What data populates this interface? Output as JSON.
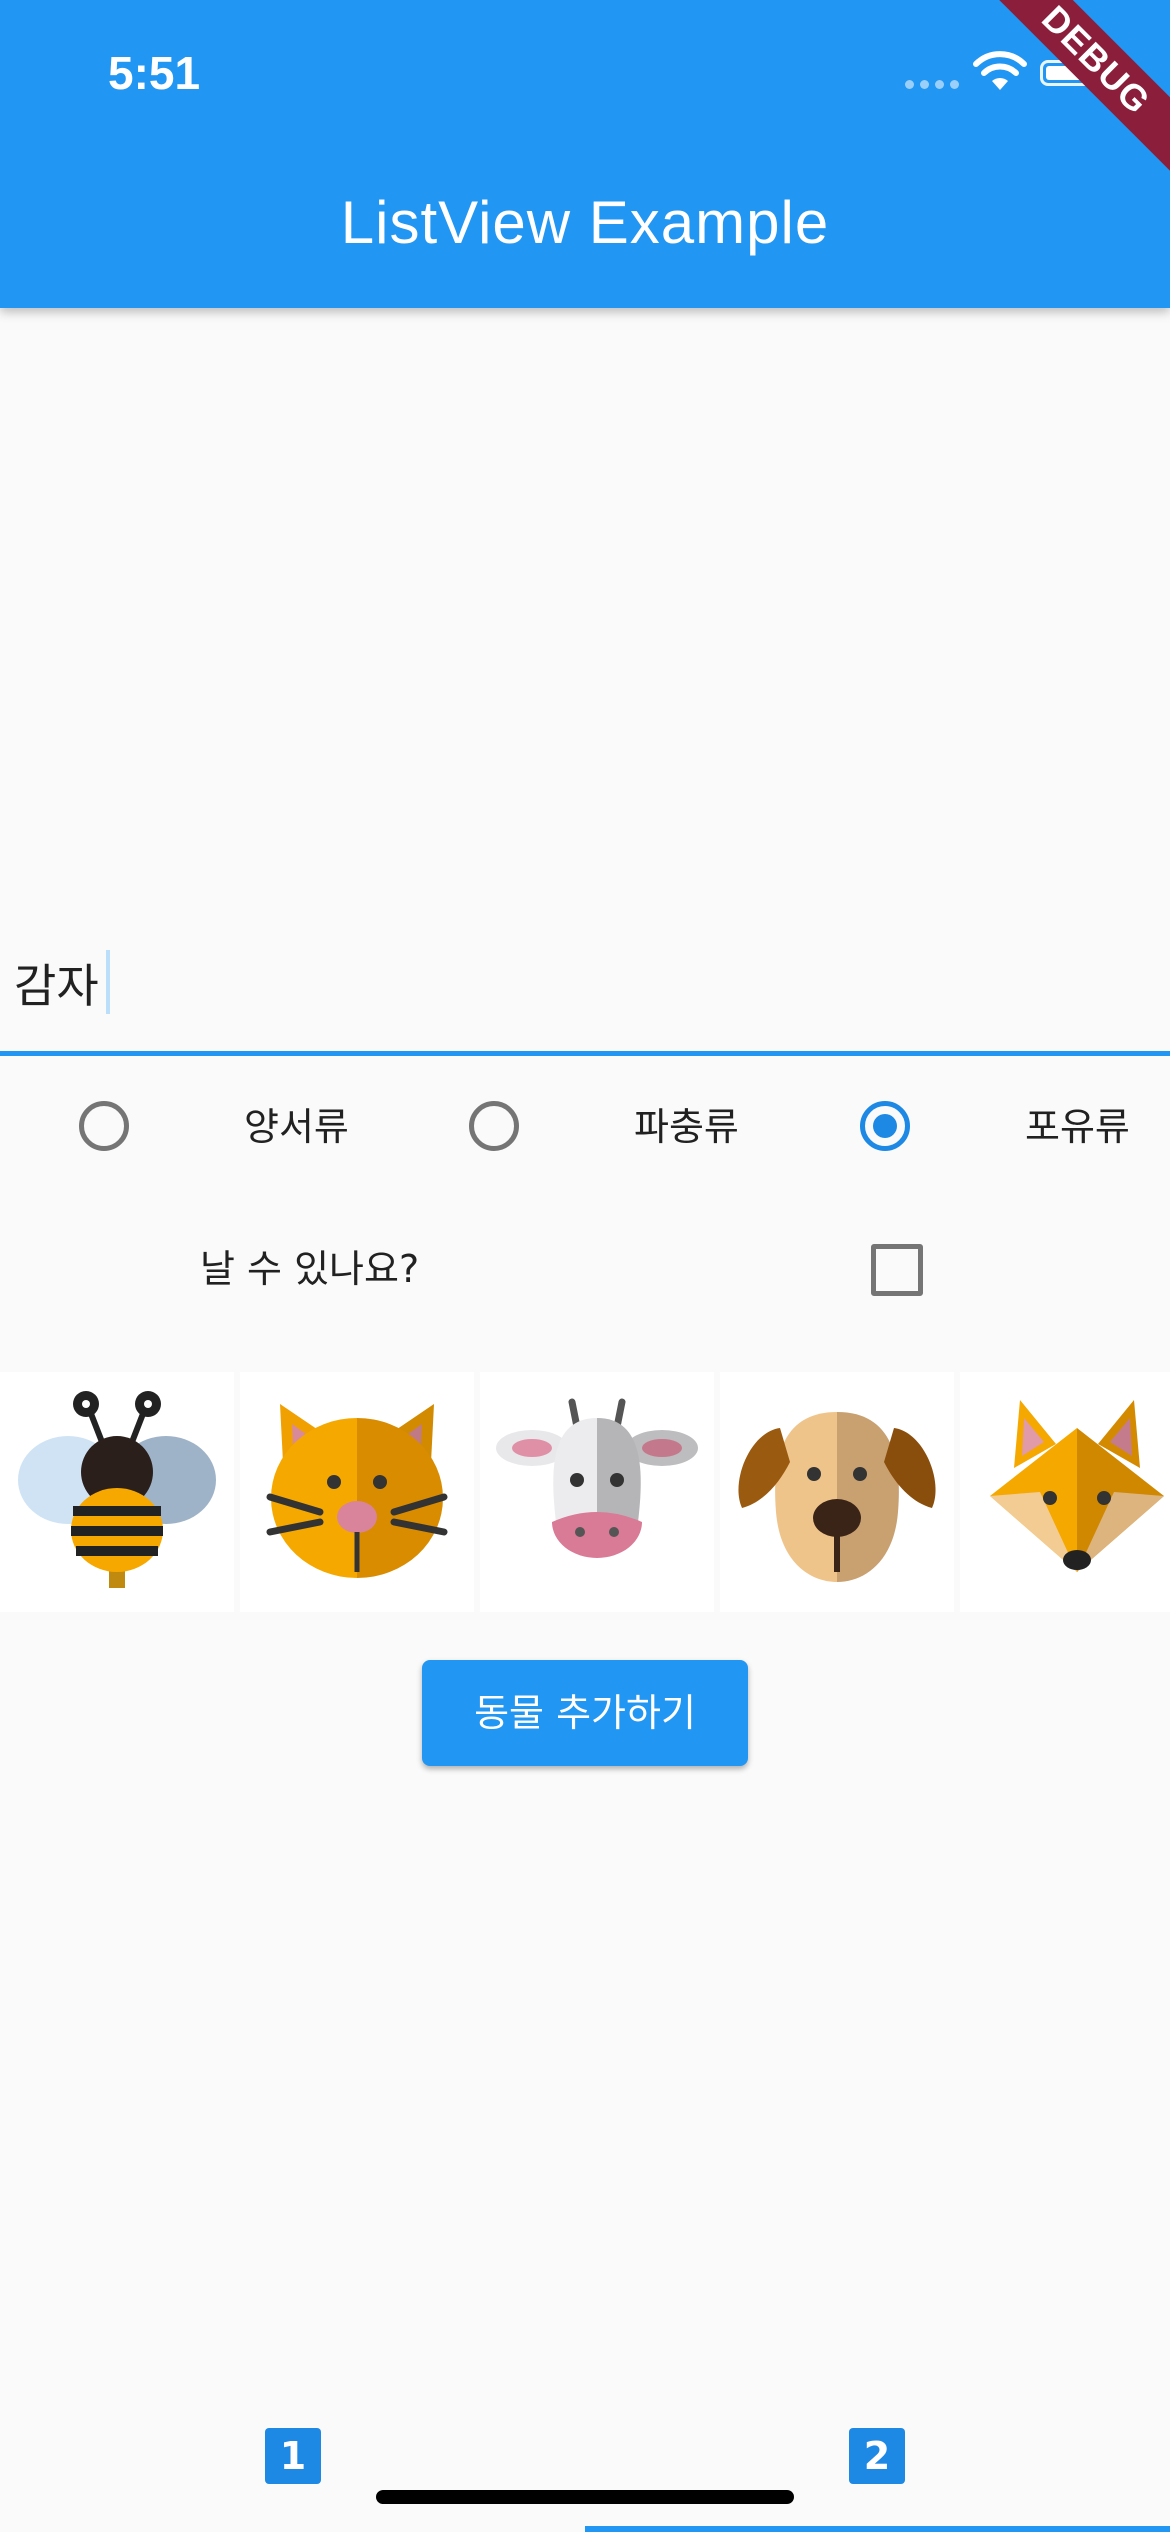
{
  "status_bar": {
    "time": "5:51"
  },
  "appbar": {
    "title": "ListView Example",
    "background": "#2196f3",
    "debug_banner": "DEBUG"
  },
  "text_field": {
    "value": "감자"
  },
  "radio_group": {
    "options": [
      {
        "label": "양서류",
        "selected": false
      },
      {
        "label": "파충류",
        "selected": false
      },
      {
        "label": "포유류",
        "selected": true
      }
    ]
  },
  "checkbox": {
    "label": "날 수 있나요?",
    "checked": false
  },
  "animals": [
    {
      "icon": "bee-icon"
    },
    {
      "icon": "cat-icon"
    },
    {
      "icon": "cow-icon"
    },
    {
      "icon": "dog-icon"
    },
    {
      "icon": "fox-icon"
    }
  ],
  "add_button": {
    "label": "동물 추가하기"
  },
  "tabs": [
    {
      "label": "1",
      "icon": "number-1-icon",
      "selected": false
    },
    {
      "label": "2",
      "icon": "number-2-icon",
      "selected": true
    }
  ],
  "colors": {
    "primary": "#2196f3",
    "radio_selected": "#1e88e5",
    "unselected": "#757575"
  }
}
